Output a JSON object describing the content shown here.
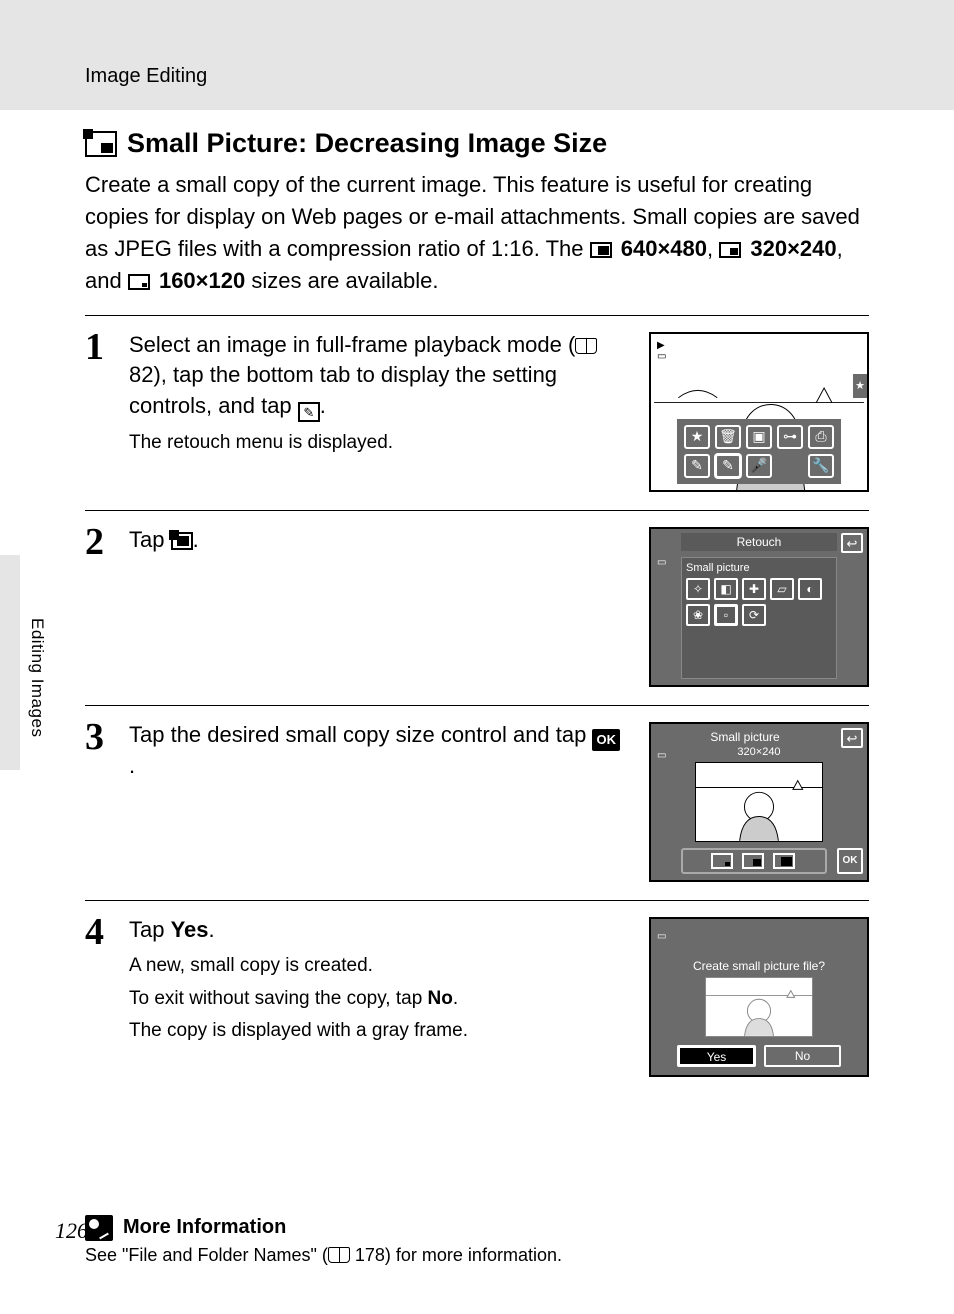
{
  "header": {
    "section": "Image Editing"
  },
  "side": {
    "label": "Editing Images"
  },
  "title": "Small Picture: Decreasing Image Size",
  "intro": {
    "p1": "Create a small copy of the current image. This feature is useful for creating copies for display on Web pages or e-mail attachments. Small copies are saved as JPEG files with a compression ratio of 1:16. The ",
    "s1": "640×480",
    "c1": ", ",
    "s2": "320×240",
    "c2": ", and ",
    "s3": "160×120",
    "p2": " sizes are available."
  },
  "steps": [
    {
      "num": "1",
      "main_a": "Select an image in full-frame playback mode (",
      "main_ref": " 82), tap the bottom tab to display the setting controls, and tap ",
      "main_end": ".",
      "sub": [
        "The retouch menu is displayed."
      ]
    },
    {
      "num": "2",
      "main_a": "Tap ",
      "main_end": ".",
      "sub": []
    },
    {
      "num": "3",
      "main_a": "Tap the desired small copy size control and tap ",
      "main_end": ".",
      "sub": []
    },
    {
      "num": "4",
      "main_a": "Tap ",
      "main_bold": "Yes",
      "main_end": ".",
      "sub": [
        "A new, small copy is created.",
        "To exit without saving the copy, tap No.",
        "The copy is displayed with a gray frame."
      ],
      "sub2_pre": "To exit without saving the copy, tap ",
      "sub2_bold": "No",
      "sub2_post": "."
    }
  ],
  "lcd2": {
    "title": "Retouch",
    "label": "Small picture"
  },
  "lcd3": {
    "title": "Small picture",
    "size": "320×240",
    "ok": "OK"
  },
  "lcd4": {
    "question": "Create small picture file?",
    "yes": "Yes",
    "no": "No"
  },
  "more": {
    "title": "More Information",
    "text_a": "See \"File and Folder Names\" (",
    "text_ref": " 178) for more information."
  },
  "page": "126"
}
